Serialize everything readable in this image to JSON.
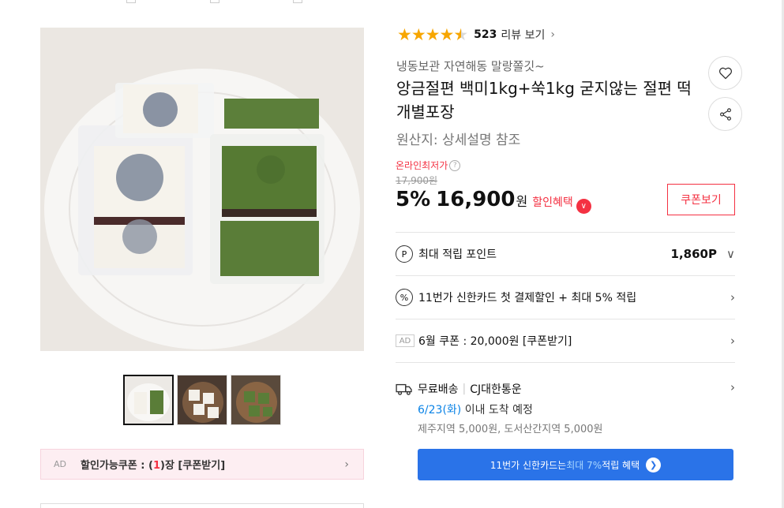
{
  "rating": {
    "stars": "★★★★",
    "half_star": "★",
    "count": "523",
    "label": "리뷰 보기"
  },
  "product": {
    "subtitle": "냉동보관 자연해동 말랑쫄깃~",
    "title": "앙금절편 백미1kg+쑥1kg 굳지않는 절편 떡 개별포장",
    "origin": "원산지:  상세설명 참조"
  },
  "price": {
    "lowest_label": "온라인최저가",
    "original": "17,900원",
    "discount": "5%",
    "final": "16,900",
    "currency": "원",
    "benefit_label": "할인혜택",
    "coupon_button": "쿠폰보기"
  },
  "rows": {
    "points": {
      "icon": "P",
      "label": "최대 적립 포인트",
      "value": "1,860P"
    },
    "card_discount": {
      "icon": "%",
      "label": "11번가 신한카드 첫 결제할인 + 최대 5% 적립"
    },
    "ad_coupon": {
      "ad": "AD",
      "label": "6월 쿠폰 : 20,000원 [쿠폰받기]"
    }
  },
  "shipping": {
    "free": "무료배송",
    "carrier": "CJ대한통운",
    "date": "6/23(화)",
    "date_suffix": " 이내 도착 예정",
    "extra": "제주지역 5,000원, 도서산간지역 5,000원"
  },
  "card_banner": {
    "prefix": "11번가 신한카드는 ",
    "highlight": "최대 7%",
    "suffix": " 적립 혜택"
  },
  "coupon_bar": {
    "ad": "AD",
    "prefix": "할인가능쿠폰 : (",
    "count": "1",
    "suffix": ")장 [쿠폰받기]"
  },
  "colors": {
    "accent_red": "#f43142",
    "star": "#f7a600",
    "banner_blue": "#2a73e8",
    "link_blue": "#0b83e6"
  },
  "icons": [
    "heart-icon",
    "share-icon",
    "chevron-right-icon",
    "point-icon",
    "percent-icon",
    "truck-icon",
    "info-icon"
  ]
}
